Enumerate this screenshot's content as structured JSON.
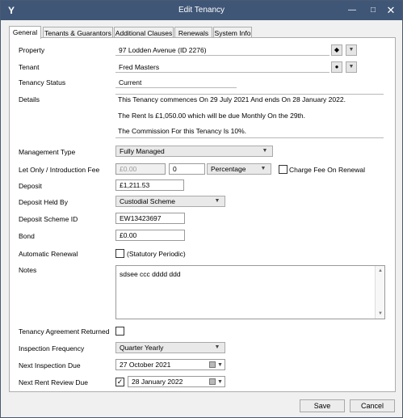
{
  "window": {
    "title": "Edit Tenancy",
    "app_icon": "Y",
    "minimize": "—",
    "maximize": "□",
    "close": "✕"
  },
  "tabs": [
    {
      "label": "General",
      "active": true
    },
    {
      "label": "Tenants & Guarantors",
      "active": false
    },
    {
      "label": "Additional Clauses",
      "active": false
    },
    {
      "label": "Renewals",
      "active": false
    },
    {
      "label": "System Info",
      "active": false
    }
  ],
  "form": {
    "property": {
      "label": "Property",
      "value": "97 Lodden Avenue (ID 2276)",
      "icon": "property-icon"
    },
    "tenant": {
      "label": "Tenant",
      "value": "Fred Masters",
      "icon": "person-icon"
    },
    "tenancy_status": {
      "label": "Tenancy Status",
      "value": "Current"
    },
    "details": {
      "label": "Details",
      "lines": [
        "This Tenancy commences On 29 July 2021 And ends On 28 January 2022.",
        "The Rent Is £1,050.00 which will be due Monthly On the 29th.",
        "The Commission For this Tenancy Is 10%."
      ]
    },
    "management_type": {
      "label": "Management Type",
      "value": "Fully Managed"
    },
    "let_only_fee": {
      "label": "Let Only / Introduction  Fee",
      "amount": "£0.00",
      "rate": "0",
      "type": "Percentage",
      "charge_fee_label": "Charge Fee On Renewal",
      "charge_fee_checked": false
    },
    "deposit": {
      "label": "Deposit",
      "value": "£1,211.53"
    },
    "deposit_held_by": {
      "label": "Deposit Held By",
      "value": "Custodial Scheme"
    },
    "deposit_scheme_id": {
      "label": "Deposit Scheme ID",
      "value": "EW13423697"
    },
    "bond": {
      "label": "Bond",
      "value": "£0.00"
    },
    "automatic_renewal": {
      "label": "Automatic Renewal",
      "text": "(Statutory Periodic)",
      "checked": false
    },
    "notes": {
      "label": "Notes",
      "value": "sdsee ccc dddd ddd"
    },
    "tenancy_agreement_returned": {
      "label": "Tenancy Agreement Returned",
      "checked": false
    },
    "inspection_frequency": {
      "label": "Inspection Frequency",
      "value": "Quarter Yearly"
    },
    "next_inspection_due": {
      "label": "Next Inspection Due",
      "value": "27  October   2021"
    },
    "next_rent_review_due": {
      "label": "Next Rent Review Due",
      "value": "28  January   2022",
      "checked": true
    }
  },
  "buttons": {
    "save": "Save",
    "cancel": "Cancel"
  },
  "symbols": {
    "dropdown": "▼",
    "check": "✓",
    "scroll_up": "▲",
    "scroll_down": "▼"
  },
  "colors": {
    "titlebar": "#3f5677",
    "border": "#adadad",
    "field_border": "#9a9a9a"
  }
}
